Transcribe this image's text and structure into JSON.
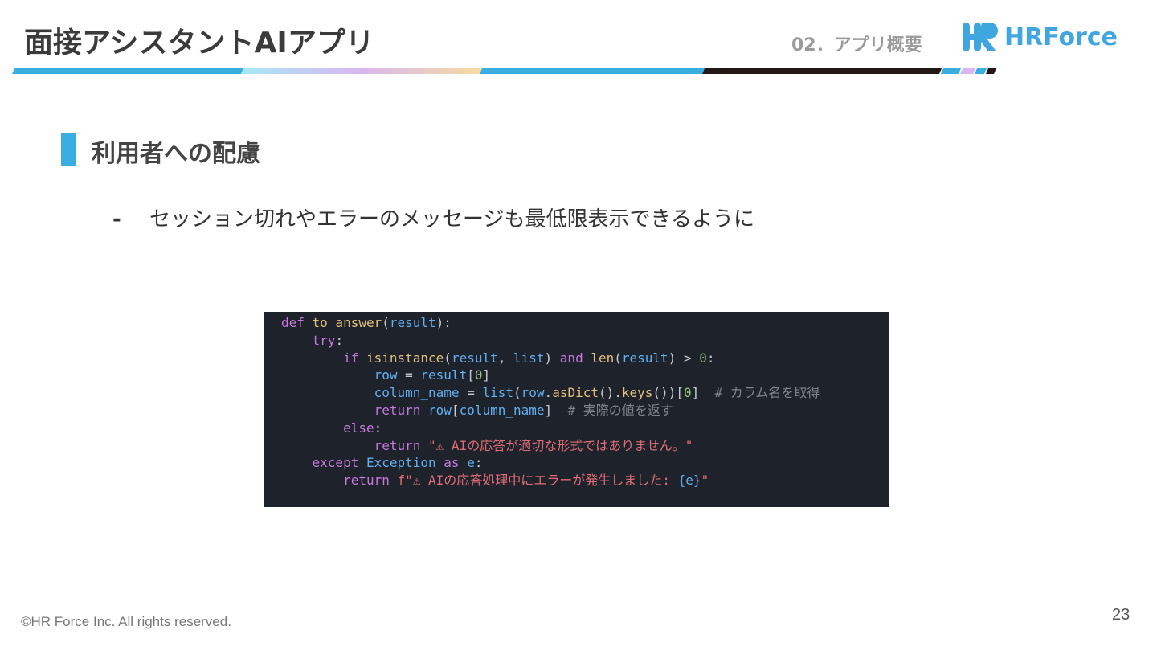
{
  "header": {
    "title": "面接アシスタントAIアプリ",
    "section": "02．アプリ概要",
    "logo_text": "HRForce",
    "band_colors": [
      "#3aaee0",
      "#a6e8f4",
      "#d9b6f0",
      "#f7dca0",
      "#3aaee0",
      "#231815"
    ]
  },
  "body": {
    "heading": "利用者への配慮",
    "bullet_dash": "-",
    "bullet_text": "セッション切れやエラーのメッセージも最低限表示できるように"
  },
  "code": {
    "lines": [
      [
        [
          "kw",
          "def "
        ],
        [
          "fn",
          "to_answer"
        ],
        [
          "pl",
          "("
        ],
        [
          "nm",
          "result"
        ],
        [
          "pl",
          "):"
        ]
      ],
      [
        [
          "pl",
          "    "
        ],
        [
          "kw",
          "try"
        ],
        [
          "pl",
          ":"
        ]
      ],
      [
        [
          "pl",
          "        "
        ],
        [
          "kw",
          "if "
        ],
        [
          "fn",
          "isinstance"
        ],
        [
          "pl",
          "("
        ],
        [
          "nm",
          "result"
        ],
        [
          "pl",
          ", "
        ],
        [
          "nm",
          "list"
        ],
        [
          "pl",
          ") "
        ],
        [
          "kw",
          "and "
        ],
        [
          "fn",
          "len"
        ],
        [
          "pl",
          "("
        ],
        [
          "nm",
          "result"
        ],
        [
          "pl",
          ") > "
        ],
        [
          "num",
          "0"
        ],
        [
          "pl",
          ":"
        ]
      ],
      [
        [
          "pl",
          "            "
        ],
        [
          "nm",
          "row"
        ],
        [
          "pl",
          " = "
        ],
        [
          "nm",
          "result"
        ],
        [
          "pl",
          "["
        ],
        [
          "num",
          "0"
        ],
        [
          "pl",
          "]"
        ]
      ],
      [
        [
          "pl",
          "            "
        ],
        [
          "nm",
          "column_name"
        ],
        [
          "pl",
          " = "
        ],
        [
          "nm",
          "list"
        ],
        [
          "pl",
          "("
        ],
        [
          "nm",
          "row"
        ],
        [
          "pl",
          "."
        ],
        [
          "fn",
          "asDict"
        ],
        [
          "pl",
          "()."
        ],
        [
          "fn",
          "keys"
        ],
        [
          "pl",
          "())["
        ],
        [
          "num",
          "0"
        ],
        [
          "pl",
          "]  "
        ],
        [
          "cm",
          "# カラム名を取得"
        ]
      ],
      [
        [
          "pl",
          "            "
        ],
        [
          "kw",
          "return "
        ],
        [
          "nm",
          "row"
        ],
        [
          "pl",
          "["
        ],
        [
          "nm",
          "column_name"
        ],
        [
          "pl",
          "]  "
        ],
        [
          "cm",
          "# 実際の値を返す"
        ]
      ],
      [
        [
          "pl",
          "        "
        ],
        [
          "kw",
          "else"
        ],
        [
          "pl",
          ":"
        ]
      ],
      [
        [
          "pl",
          "            "
        ],
        [
          "kw",
          "return "
        ],
        [
          "st",
          "\"⚠ AIの応答が適切な形式ではありません。\""
        ]
      ],
      [
        [
          "pl",
          "    "
        ],
        [
          "kw",
          "except "
        ],
        [
          "nm",
          "Exception "
        ],
        [
          "kw",
          "as "
        ],
        [
          "nm",
          "e"
        ],
        [
          "pl",
          ":"
        ]
      ],
      [
        [
          "pl",
          "        "
        ],
        [
          "kw",
          "return "
        ],
        [
          "st",
          "f\"⚠ AIの応答処理中にエラーが発生しました: "
        ],
        [
          "nm",
          "{e}"
        ],
        [
          "st",
          "\""
        ]
      ]
    ]
  },
  "footer": {
    "copyright": "©HR Force Inc. All rights reserved.",
    "page_number": "23"
  }
}
